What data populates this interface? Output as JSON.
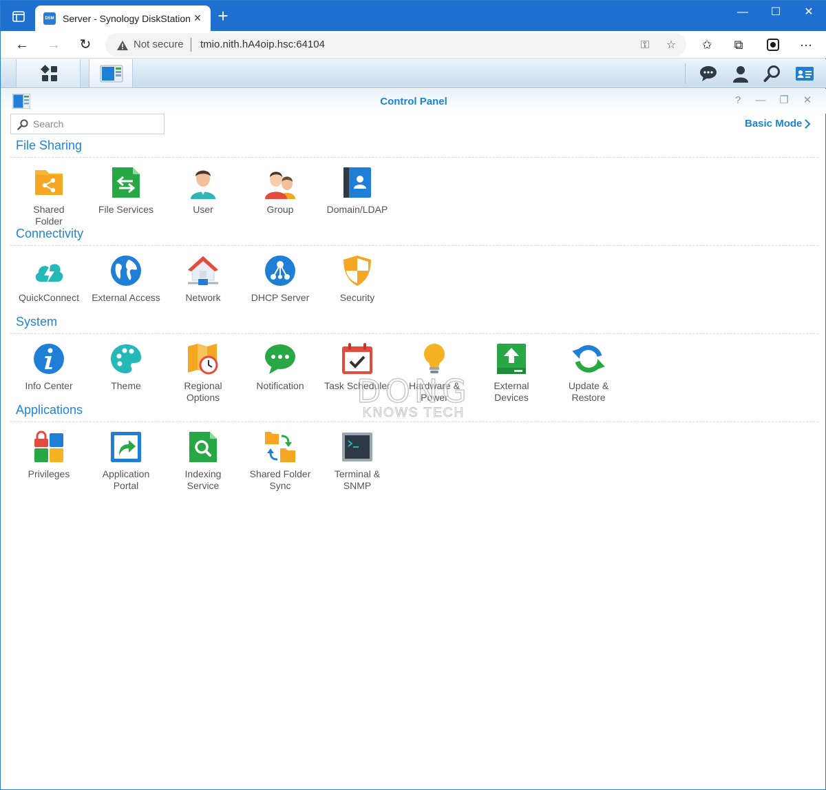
{
  "browser": {
    "tab_title": "Server - Synology DiskStation",
    "favicon_text": "DSM",
    "security_label": "Not secure",
    "url": "tmio.nith.hA4oip.hsc:64104"
  },
  "dsm": {
    "window_title": "Control Panel"
  },
  "control_panel": {
    "search_placeholder": "Search",
    "basic_mode_label": "Basic Mode",
    "sections": [
      {
        "title": "File Sharing",
        "items": [
          {
            "label": "Shared\nFolder",
            "icon": "shared-folder-icon"
          },
          {
            "label": "File Services",
            "icon": "file-services-icon"
          },
          {
            "label": "User",
            "icon": "user-icon"
          },
          {
            "label": "Group",
            "icon": "group-icon"
          },
          {
            "label": "Domain/LDAP",
            "icon": "domain-ldap-icon"
          }
        ]
      },
      {
        "title": "Connectivity",
        "items": [
          {
            "label": "QuickConnect",
            "icon": "quickconnect-icon"
          },
          {
            "label": "External Access",
            "icon": "external-access-icon"
          },
          {
            "label": "Network",
            "icon": "network-icon"
          },
          {
            "label": "DHCP Server",
            "icon": "dhcp-server-icon"
          },
          {
            "label": "Security",
            "icon": "security-shield-icon"
          }
        ]
      },
      {
        "title": "System",
        "items": [
          {
            "label": "Info Center",
            "icon": "info-center-icon"
          },
          {
            "label": "Theme",
            "icon": "theme-palette-icon"
          },
          {
            "label": "Regional\nOptions",
            "icon": "regional-options-icon"
          },
          {
            "label": "Notification",
            "icon": "notification-icon"
          },
          {
            "label": "Task Scheduler",
            "icon": "task-scheduler-icon"
          },
          {
            "label": "Hardware &\nPower",
            "icon": "hardware-power-icon"
          },
          {
            "label": "External\nDevices",
            "icon": "external-devices-icon"
          },
          {
            "label": "Update &\nRestore",
            "icon": "update-restore-icon"
          }
        ]
      },
      {
        "title": "Applications",
        "items": [
          {
            "label": "Privileges",
            "icon": "privileges-icon"
          },
          {
            "label": "Application\nPortal",
            "icon": "application-portal-icon"
          },
          {
            "label": "Indexing\nService",
            "icon": "indexing-service-icon"
          },
          {
            "label": "Shared Folder\nSync",
            "icon": "shared-folder-sync-icon"
          },
          {
            "label": "Terminal &\nSNMP",
            "icon": "terminal-snmp-icon"
          }
        ]
      }
    ]
  },
  "watermark": {
    "line1": "DONG",
    "line2": "KNOWS TECH"
  },
  "colors": {
    "browser_accent": "#1f6fd0",
    "dsm_blue": "#1b86d6"
  }
}
